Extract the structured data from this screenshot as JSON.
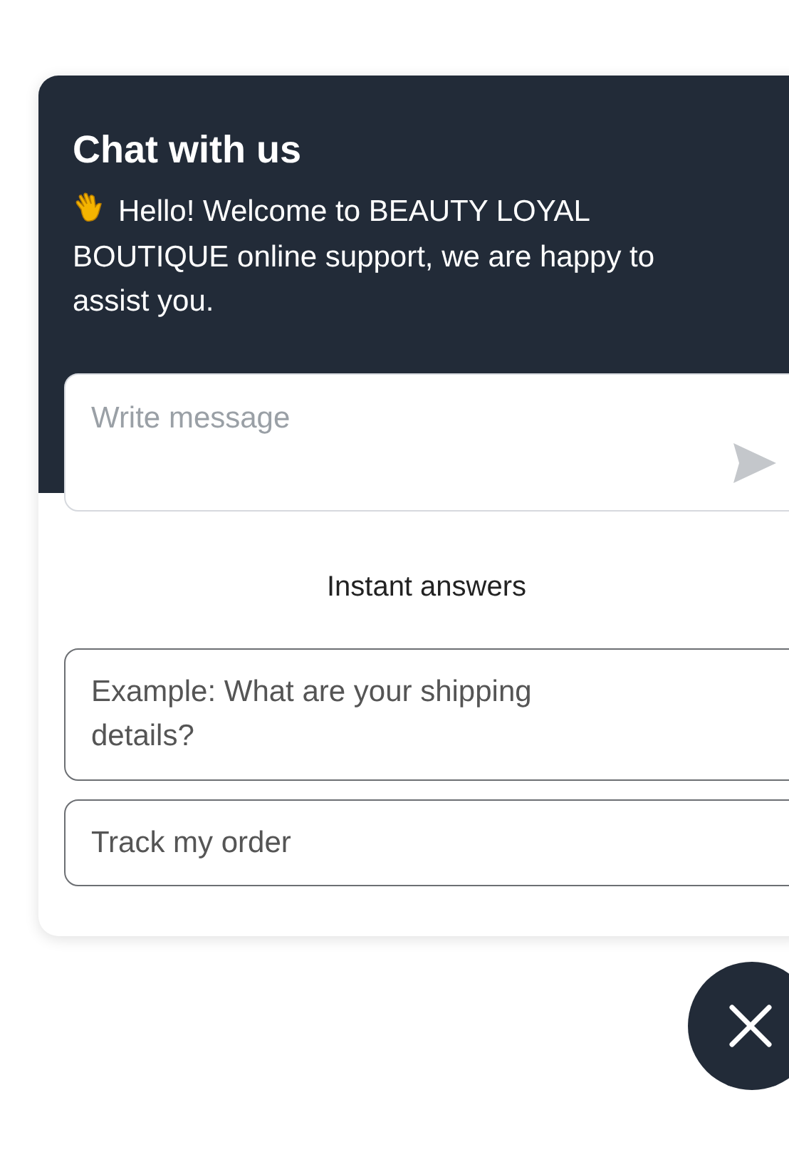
{
  "chat": {
    "title": "Chat with us",
    "greeting": "Hello! Welcome to BEAUTY LOYAL BOUTIQUE online support, we are happy to assist you.",
    "message": {
      "placeholder": "Write message"
    },
    "instant_answers": {
      "title": "Instant answers",
      "items": [
        {
          "label": "Example: What are your shipping details?"
        },
        {
          "label": "Track my order"
        }
      ]
    }
  }
}
